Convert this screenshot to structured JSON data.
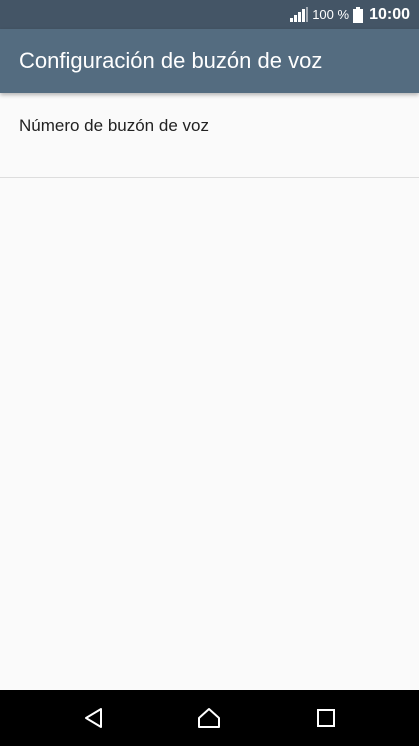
{
  "status_bar": {
    "battery_text": "100 %",
    "time": "10:00",
    "icons": [
      "signal-icon",
      "battery-icon"
    ]
  },
  "app_bar": {
    "title": "Configuración de buzón de voz"
  },
  "settings": {
    "items": [
      {
        "label": "Número de buzón de voz"
      }
    ]
  },
  "nav_bar": {
    "buttons": [
      "back-icon",
      "home-icon",
      "recents-icon"
    ]
  },
  "colors": {
    "status_bar": "#445566",
    "app_bar": "#546c80",
    "background": "#fafafa",
    "nav_bar": "#000000"
  }
}
